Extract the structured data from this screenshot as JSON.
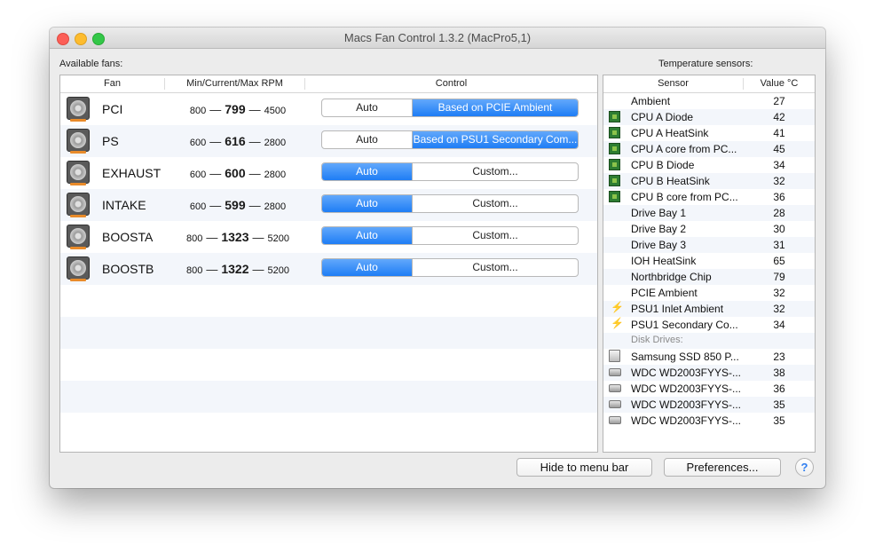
{
  "window": {
    "title": "Macs Fan Control 1.3.2 (MacPro5,1)"
  },
  "fans_panel": {
    "label": "Available fans:",
    "columns": [
      "Fan",
      "Min/Current/Max RPM",
      "Control"
    ],
    "rows": [
      {
        "name": "PCI",
        "min": "800",
        "current": "799",
        "max": "4500",
        "control_a": "Auto",
        "control_b": "Based on PCIE Ambient",
        "selected": "b"
      },
      {
        "name": "PS",
        "min": "600",
        "current": "616",
        "max": "2800",
        "control_a": "Auto",
        "control_b": "Based on PSU1 Secondary Com...",
        "selected": "b"
      },
      {
        "name": "EXHAUST",
        "min": "600",
        "current": "600",
        "max": "2800",
        "control_a": "Auto",
        "control_b": "Custom...",
        "selected": "a"
      },
      {
        "name": "INTAKE",
        "min": "600",
        "current": "599",
        "max": "2800",
        "control_a": "Auto",
        "control_b": "Custom...",
        "selected": "a"
      },
      {
        "name": "BOOSTA",
        "min": "800",
        "current": "1323",
        "max": "5200",
        "control_a": "Auto",
        "control_b": "Custom...",
        "selected": "a"
      },
      {
        "name": "BOOSTB",
        "min": "800",
        "current": "1322",
        "max": "5200",
        "control_a": "Auto",
        "control_b": "Custom...",
        "selected": "a"
      }
    ],
    "dash": "—"
  },
  "sensors_panel": {
    "label": "Temperature sensors:",
    "columns": [
      "Sensor",
      "Value °C"
    ],
    "rows": [
      {
        "kind": "none",
        "name": "Ambient",
        "value": "27"
      },
      {
        "kind": "chip",
        "name": "CPU A Diode",
        "value": "42"
      },
      {
        "kind": "chip",
        "name": "CPU A HeatSink",
        "value": "41"
      },
      {
        "kind": "chip",
        "name": "CPU A core from PC...",
        "value": "45"
      },
      {
        "kind": "chip",
        "name": "CPU B Diode",
        "value": "34"
      },
      {
        "kind": "chip",
        "name": "CPU B HeatSink",
        "value": "32"
      },
      {
        "kind": "chip",
        "name": "CPU B core from PC...",
        "value": "36"
      },
      {
        "kind": "none",
        "name": "Drive Bay 1",
        "value": "28"
      },
      {
        "kind": "none",
        "name": "Drive Bay 2",
        "value": "30"
      },
      {
        "kind": "none",
        "name": "Drive Bay 3",
        "value": "31"
      },
      {
        "kind": "none",
        "name": "IOH HeatSink",
        "value": "65"
      },
      {
        "kind": "none",
        "name": "Northbridge Chip",
        "value": "79"
      },
      {
        "kind": "none",
        "name": "PCIE Ambient",
        "value": "32"
      },
      {
        "kind": "bolt",
        "name": "PSU1 Inlet Ambient",
        "value": "32"
      },
      {
        "kind": "bolt",
        "name": "PSU1 Secondary Co...",
        "value": "34"
      },
      {
        "kind": "group",
        "name": "Disk Drives:",
        "value": ""
      },
      {
        "kind": "ssd",
        "name": "Samsung SSD 850 P...",
        "value": "23"
      },
      {
        "kind": "disk",
        "name": "WDC WD2003FYYS-...",
        "value": "38"
      },
      {
        "kind": "disk",
        "name": "WDC WD2003FYYS-...",
        "value": "36"
      },
      {
        "kind": "disk",
        "name": "WDC WD2003FYYS-...",
        "value": "35"
      },
      {
        "kind": "disk",
        "name": "WDC WD2003FYYS-...",
        "value": "35"
      }
    ]
  },
  "footer": {
    "hide_label": "Hide to menu bar",
    "prefs_label": "Preferences...",
    "help_label": "?"
  },
  "colors": {
    "accent": "#2f8bfa",
    "close": "#fc5f57",
    "minimize": "#fdbc2e",
    "maximize": "#33c748"
  }
}
